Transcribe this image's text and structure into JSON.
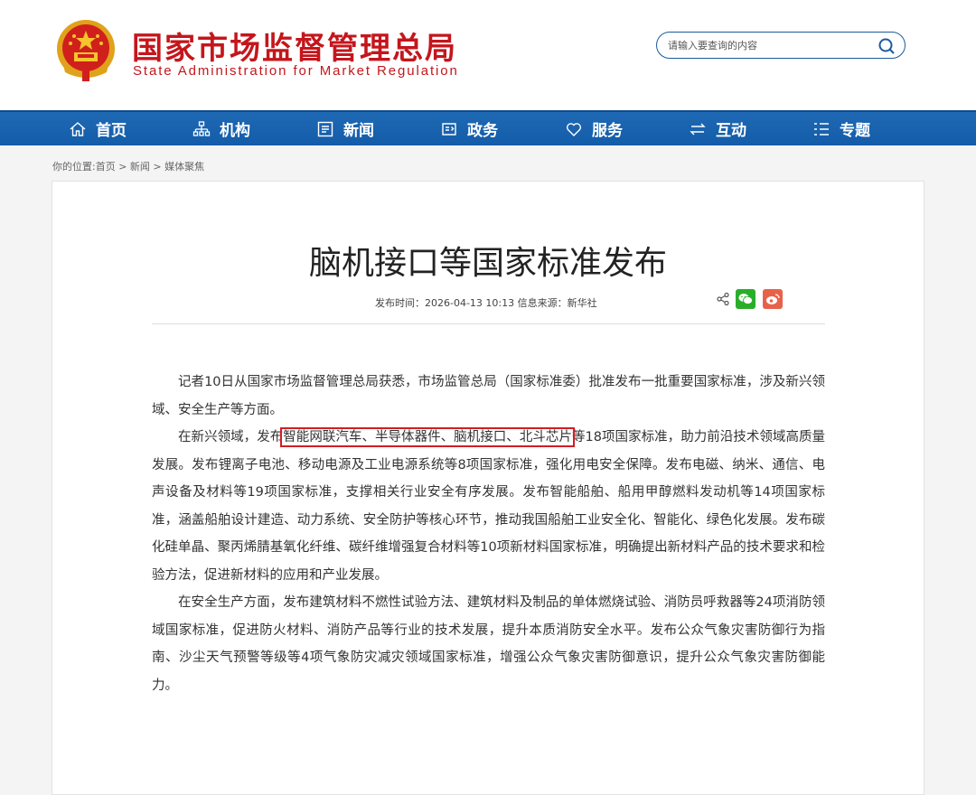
{
  "header": {
    "title_cn": "国家市场监督管理总局",
    "title_en": "State Administration for Market Regulation",
    "search_placeholder": "请输入要查询的内容"
  },
  "nav": [
    {
      "label": "首页",
      "icon": "home-icon"
    },
    {
      "label": "机构",
      "icon": "org-chart-icon"
    },
    {
      "label": "新闻",
      "icon": "news-icon"
    },
    {
      "label": "政务",
      "icon": "document-icon"
    },
    {
      "label": "服务",
      "icon": "heart-icon"
    },
    {
      "label": "互动",
      "icon": "exchange-icon"
    },
    {
      "label": "专题",
      "icon": "list-icon"
    }
  ],
  "breadcrumb": "你的位置:首页 > 新闻 > 媒体聚焦",
  "article": {
    "title": "脑机接口等国家标准发布",
    "meta": "发布时间：2026-04-13 10:13   信息来源：新华社",
    "p1": "记者10日从国家市场监督管理总局获悉，市场监管总局（国家标准委）批准发布一批重要国家标准，涉及新兴领域、安全生产等方面。",
    "p2_before": "在新兴领域，发布",
    "p2_highlight": "智能网联汽车、半导体器件、脑机接口、北斗芯片",
    "p2_after": "等18项国家标准，助力前沿技术领域高质量发展。发布锂离子电池、移动电源及工业电源系统等8项国家标准，强化用电安全保障。发布电磁、纳米、通信、电声设备及材料等19项国家标准，支撑相关行业安全有序发展。发布智能船舶、船用甲醇燃料发动机等14项国家标准，涵盖船舶设计建造、动力系统、安全防护等核心环节，推动我国船舶工业安全化、智能化、绿色化发展。发布碳化硅单晶、聚丙烯腈基氧化纤维、碳纤维增强复合材料等10项新材料国家标准，明确提出新材料产品的技术要求和检验方法，促进新材料的应用和产业发展。",
    "p3": "在安全生产方面，发布建筑材料不燃性试验方法、建筑材料及制品的单体燃烧试验、消防员呼救器等24项消防领域国家标准，促进防火材料、消防产品等行业的技术发展，提升本质消防安全水平。发布公众气象灾害防御行为指南、沙尘天气预警等级等4项气象防灾减灾领域国家标准，增强公众气象灾害防御意识，提升公众气象灾害防御能力。"
  },
  "colors": {
    "brand_red": "#c4161c",
    "nav_blue": "#1a64b0",
    "highlight_box": "#d01e24"
  }
}
